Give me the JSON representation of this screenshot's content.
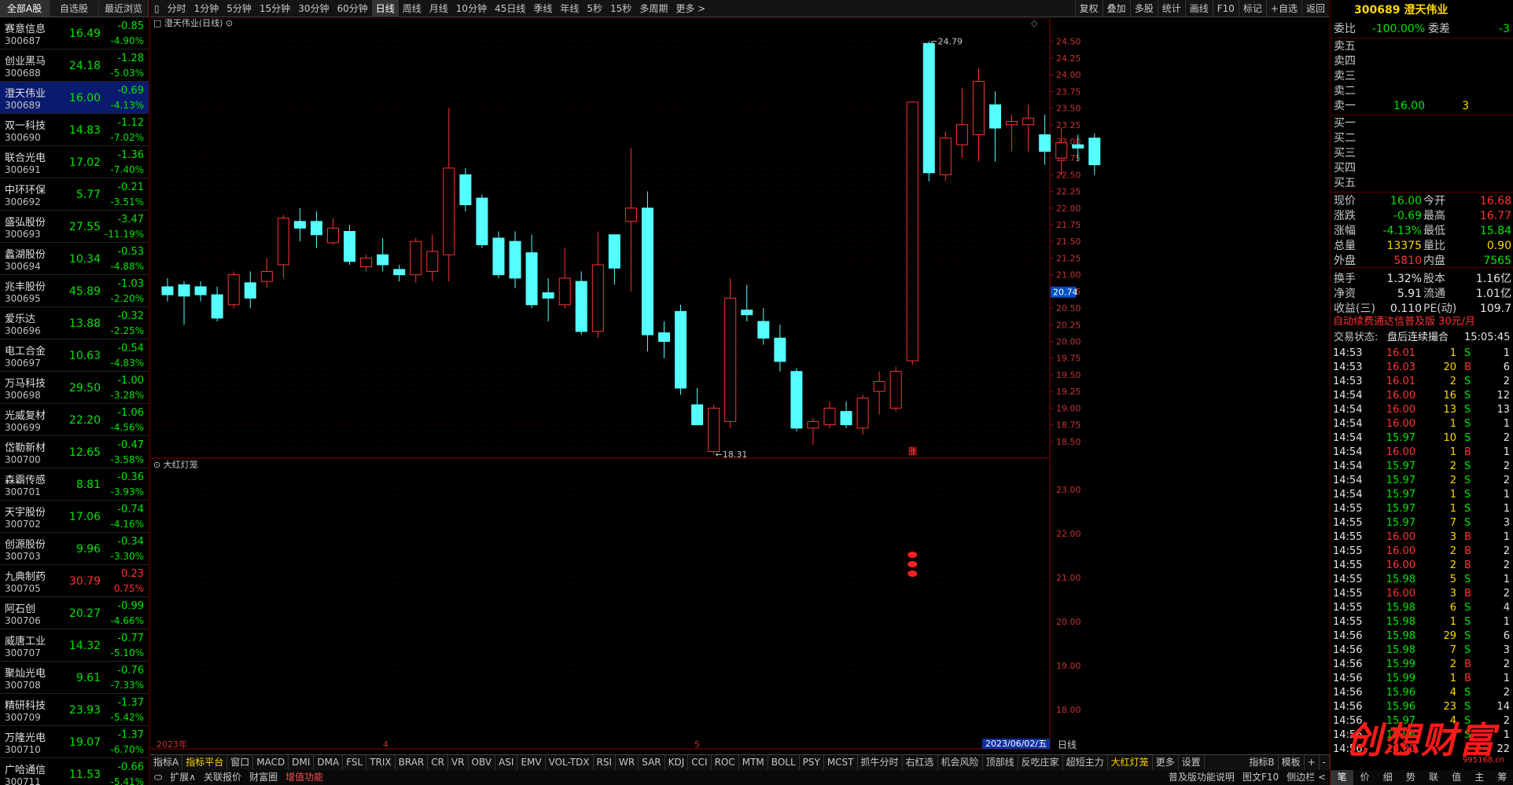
{
  "left_tabs": [
    "全部A股",
    "自选股",
    "最近浏览"
  ],
  "stocks": [
    {
      "name": "赛意信息",
      "code": "300687",
      "price": "16.49",
      "chg": "-0.85",
      "pct": "-4.90%",
      "dir": "dn"
    },
    {
      "name": "创业黑马",
      "code": "300688",
      "price": "24.18",
      "chg": "-1.28",
      "pct": "-5.03%",
      "dir": "dn"
    },
    {
      "name": "澄天伟业",
      "code": "300689",
      "price": "16.00",
      "chg": "-0.69",
      "pct": "-4.13%",
      "dir": "dn",
      "sel": true
    },
    {
      "name": "双一科技",
      "code": "300690",
      "price": "14.83",
      "chg": "-1.12",
      "pct": "-7.02%",
      "dir": "dn"
    },
    {
      "name": "联合光电",
      "code": "300691",
      "price": "17.02",
      "chg": "-1.36",
      "pct": "-7.40%",
      "dir": "dn"
    },
    {
      "name": "中环环保",
      "code": "300692",
      "price": "5.77",
      "chg": "-0.21",
      "pct": "-3.51%",
      "dir": "dn"
    },
    {
      "name": "盛弘股份",
      "code": "300693",
      "price": "27.55",
      "chg": "-3.47",
      "pct": "-11.19%",
      "dir": "dn"
    },
    {
      "name": "蠡湖股份",
      "code": "300694",
      "price": "10.34",
      "chg": "-0.53",
      "pct": "-4.88%",
      "dir": "dn"
    },
    {
      "name": "兆丰股份",
      "code": "300695",
      "price": "45.89",
      "chg": "-1.03",
      "pct": "-2.20%",
      "dir": "dn"
    },
    {
      "name": "爱乐达",
      "code": "300696",
      "price": "13.88",
      "chg": "-0.32",
      "pct": "-2.25%",
      "dir": "dn"
    },
    {
      "name": "电工合金",
      "code": "300697",
      "price": "10.63",
      "chg": "-0.54",
      "pct": "-4.83%",
      "dir": "dn"
    },
    {
      "name": "万马科技",
      "code": "300698",
      "price": "29.50",
      "chg": "-1.00",
      "pct": "-3.28%",
      "dir": "dn"
    },
    {
      "name": "光威复材",
      "code": "300699",
      "price": "22.20",
      "chg": "-1.06",
      "pct": "-4.56%",
      "dir": "dn"
    },
    {
      "name": "岱勒新材",
      "code": "300700",
      "price": "12.65",
      "chg": "-0.47",
      "pct": "-3.58%",
      "dir": "dn"
    },
    {
      "name": "森霸传感",
      "code": "300701",
      "price": "8.81",
      "chg": "-0.36",
      "pct": "-3.93%",
      "dir": "dn"
    },
    {
      "name": "天宇股份",
      "code": "300702",
      "price": "17.06",
      "chg": "-0.74",
      "pct": "-4.16%",
      "dir": "dn"
    },
    {
      "name": "创源股份",
      "code": "300703",
      "price": "9.96",
      "chg": "-0.34",
      "pct": "-3.30%",
      "dir": "dn"
    },
    {
      "name": "九典制药",
      "code": "300705",
      "price": "30.79",
      "chg": "0.23",
      "pct": "0.75%",
      "dir": "up"
    },
    {
      "name": "阿石创",
      "code": "300706",
      "price": "20.27",
      "chg": "-0.99",
      "pct": "-4.66%",
      "dir": "dn"
    },
    {
      "name": "威唐工业",
      "code": "300707",
      "price": "14.32",
      "chg": "-0.77",
      "pct": "-5.10%",
      "dir": "dn"
    },
    {
      "name": "聚灿光电",
      "code": "300708",
      "price": "9.61",
      "chg": "-0.76",
      "pct": "-7.33%",
      "dir": "dn"
    },
    {
      "name": "精研科技",
      "code": "300709",
      "price": "23.93",
      "chg": "-1.37",
      "pct": "-5.42%",
      "dir": "dn"
    },
    {
      "name": "万隆光电",
      "code": "300710",
      "price": "19.07",
      "chg": "-1.37",
      "pct": "-6.70%",
      "dir": "dn"
    },
    {
      "name": "广哈通信",
      "code": "300711",
      "price": "11.53",
      "chg": "-0.66",
      "pct": "-5.41%",
      "dir": "dn"
    }
  ],
  "top_tabs": [
    "分时",
    "1分钟",
    "5分钟",
    "15分钟",
    "30分钟",
    "60分钟",
    "日线",
    "周线",
    "月线",
    "10分钟",
    "45日线",
    "季线",
    "年线",
    "5秒",
    "15秒",
    "多周期",
    "更多 >"
  ],
  "top_active": "日线",
  "top_right": [
    "复权",
    "叠加",
    "多股",
    "统计",
    "画线",
    "F10",
    "标记",
    "+自选",
    "返回"
  ],
  "chart_title": "澄天伟业(日线)",
  "ind_title": "大红灯笼",
  "chart_data": {
    "type": "candlestick",
    "ylim": [
      18.25,
      24.85
    ],
    "yticks": [
      "24.50",
      "24.25",
      "24.00",
      "23.75",
      "23.50",
      "23.25",
      "23.00",
      "22.75",
      "22.50",
      "22.25",
      "22.00",
      "21.75",
      "21.50",
      "21.25",
      "21.00",
      "20.75",
      "20.50",
      "20.25",
      "20.00",
      "19.75",
      "19.50",
      "19.25",
      "19.00",
      "18.75",
      "18.50"
    ],
    "price_label": "20.74",
    "high_label": "24.79",
    "low_label": "18.31",
    "x_labels": [
      "2023年",
      "4",
      "5"
    ],
    "date_label": "2023/06/02/五",
    "ind_yticks": [
      "23.00",
      "22.00",
      "21.00",
      "20.00",
      "19.00",
      "18.00"
    ],
    "candles": [
      [
        20.82,
        20.7,
        20.95,
        20.6
      ],
      [
        20.85,
        20.68,
        20.9,
        20.25
      ],
      [
        20.82,
        20.7,
        20.9,
        20.6
      ],
      [
        20.7,
        20.35,
        20.82,
        20.3
      ],
      [
        20.55,
        21.0,
        21.05,
        20.5
      ],
      [
        20.88,
        20.65,
        21.05,
        20.5
      ],
      [
        20.9,
        21.05,
        21.25,
        20.8
      ],
      [
        21.15,
        21.85,
        21.9,
        20.95
      ],
      [
        21.8,
        21.7,
        22.0,
        21.5
      ],
      [
        21.8,
        21.6,
        21.95,
        21.4
      ],
      [
        21.48,
        21.7,
        21.85,
        21.45
      ],
      [
        21.65,
        21.2,
        21.75,
        21.15
      ],
      [
        21.12,
        21.25,
        21.3,
        21.05
      ],
      [
        21.3,
        21.15,
        21.55,
        21.05
      ],
      [
        21.08,
        21.0,
        21.15,
        20.9
      ],
      [
        21.0,
        21.5,
        21.55,
        20.88
      ],
      [
        21.05,
        21.35,
        21.6,
        20.9
      ],
      [
        21.3,
        22.6,
        23.5,
        20.9
      ],
      [
        22.5,
        22.05,
        22.6,
        21.95
      ],
      [
        22.15,
        21.45,
        22.2,
        21.4
      ],
      [
        21.55,
        21.0,
        21.65,
        20.95
      ],
      [
        21.5,
        20.95,
        21.65,
        20.8
      ],
      [
        21.33,
        20.55,
        21.6,
        20.5
      ],
      [
        20.73,
        20.65,
        20.95,
        20.3
      ],
      [
        20.55,
        20.95,
        21.4,
        20.5
      ],
      [
        20.9,
        20.15,
        21.05,
        20.1
      ],
      [
        20.15,
        21.15,
        21.65,
        20.05
      ],
      [
        21.6,
        21.1,
        21.55,
        20.85
      ],
      [
        21.8,
        22.0,
        22.9,
        20.75
      ],
      [
        22.0,
        20.1,
        22.25,
        19.85
      ],
      [
        20.13,
        20.0,
        20.3,
        19.75
      ],
      [
        20.45,
        19.3,
        20.55,
        19.2
      ],
      [
        19.05,
        18.75,
        19.3,
        18.75
      ],
      [
        18.35,
        19.0,
        19.05,
        18.31
      ],
      [
        18.8,
        20.65,
        20.95,
        18.7
      ],
      [
        20.47,
        20.4,
        20.85,
        20.3
      ],
      [
        20.3,
        20.05,
        20.5,
        19.95
      ],
      [
        20.05,
        19.7,
        20.25,
        19.55
      ],
      [
        19.55,
        18.7,
        19.6,
        18.65
      ],
      [
        18.7,
        18.8,
        18.85,
        18.45
      ],
      [
        18.75,
        19.0,
        19.1,
        18.7
      ],
      [
        18.95,
        18.75,
        19.1,
        18.7
      ],
      [
        18.7,
        19.15,
        19.2,
        18.6
      ],
      [
        19.25,
        19.4,
        19.55,
        18.9
      ],
      [
        19.0,
        19.55,
        19.62,
        18.95
      ],
      [
        19.71,
        23.59,
        23.6,
        19.65
      ],
      [
        24.47,
        22.53,
        24.5,
        22.4
      ],
      [
        22.5,
        23.05,
        23.15,
        22.4
      ],
      [
        22.95,
        23.25,
        23.8,
        22.75
      ],
      [
        23.1,
        23.9,
        24.1,
        22.7
      ],
      [
        23.55,
        23.2,
        23.75,
        22.7
      ],
      [
        23.25,
        23.3,
        23.4,
        22.85
      ],
      [
        23.25,
        23.35,
        23.55,
        22.85
      ],
      [
        23.1,
        22.85,
        23.4,
        22.65
      ],
      [
        22.75,
        22.98,
        23.2,
        22.5
      ],
      [
        22.95,
        22.9,
        23.1,
        22.7
      ],
      [
        23.05,
        22.65,
        23.12,
        22.5
      ]
    ],
    "up_candle_label": "涨"
  },
  "quote": {
    "code": "300689",
    "name": "澄天伟业",
    "weibi_label": "委比",
    "weibi": "-100.00%",
    "weicha_label": "委差",
    "weicha": "-3",
    "sell": [
      [
        "卖五",
        "",
        ""
      ],
      [
        "卖四",
        "",
        ""
      ],
      [
        "卖三",
        "",
        ""
      ],
      [
        "卖二",
        "",
        ""
      ],
      [
        "卖一",
        "16.00",
        "3"
      ]
    ],
    "buy": [
      [
        "买一",
        "",
        ""
      ],
      [
        "买二",
        "",
        ""
      ],
      [
        "买三",
        "",
        ""
      ],
      [
        "买四",
        "",
        ""
      ],
      [
        "买五",
        "",
        ""
      ]
    ],
    "stats": [
      [
        "现价",
        "16.00",
        "dn",
        "今开",
        "16.68",
        "up"
      ],
      [
        "涨跌",
        "-0.69",
        "dn",
        "最高",
        "16.77",
        "up"
      ],
      [
        "涨幅",
        "-4.13%",
        "dn",
        "最低",
        "15.84",
        "dn"
      ],
      [
        "总量",
        "13375",
        "yl",
        "量比",
        "0.90",
        "yl"
      ],
      [
        "外盘",
        "5810",
        "up",
        "内盘",
        "7565",
        "dn"
      ],
      [
        "换手",
        "1.32%",
        "wh",
        "股本",
        "1.16亿",
        "wh"
      ],
      [
        "净资",
        "5.91",
        "wh",
        "流通",
        "1.01亿",
        "wh"
      ],
      [
        "收益(三)",
        "0.110",
        "wh",
        "PE(动)",
        "109.7",
        "wh"
      ]
    ],
    "ad": "自动续费通达信普及版 30元/月",
    "status_label": "交易状态:",
    "status": "盘后连续撮合",
    "status_time": "15:05:45",
    "ticks": [
      [
        "14:53",
        "16.01",
        "1",
        "S",
        "1"
      ],
      [
        "14:53",
        "16.03",
        "20",
        "B",
        "6"
      ],
      [
        "14:53",
        "16.01",
        "2",
        "S",
        "2"
      ],
      [
        "14:54",
        "16.00",
        "16",
        "S",
        "12"
      ],
      [
        "14:54",
        "16.00",
        "13",
        "S",
        "13"
      ],
      [
        "14:54",
        "16.00",
        "1",
        "S",
        "1"
      ],
      [
        "14:54",
        "15.97",
        "10",
        "S",
        "2"
      ],
      [
        "14:54",
        "16.00",
        "1",
        "B",
        "1"
      ],
      [
        "14:54",
        "15.97",
        "2",
        "S",
        "2"
      ],
      [
        "14:54",
        "15.97",
        "2",
        "S",
        "2"
      ],
      [
        "14:54",
        "15.97",
        "1",
        "S",
        "1"
      ],
      [
        "14:55",
        "15.97",
        "1",
        "S",
        "1"
      ],
      [
        "14:55",
        "15.97",
        "7",
        "S",
        "3"
      ],
      [
        "14:55",
        "16.00",
        "3",
        "B",
        "1"
      ],
      [
        "14:55",
        "16.00",
        "2",
        "B",
        "2"
      ],
      [
        "14:55",
        "16.00",
        "2",
        "B",
        "2"
      ],
      [
        "14:55",
        "15.98",
        "5",
        "S",
        "1"
      ],
      [
        "14:55",
        "16.00",
        "3",
        "B",
        "2"
      ],
      [
        "14:55",
        "15.98",
        "6",
        "S",
        "4"
      ],
      [
        "14:55",
        "15.98",
        "1",
        "S",
        "1"
      ],
      [
        "14:56",
        "15.98",
        "29",
        "S",
        "6"
      ],
      [
        "14:56",
        "15.98",
        "7",
        "S",
        "3"
      ],
      [
        "14:56",
        "15.99",
        "2",
        "B",
        "2"
      ],
      [
        "14:56",
        "15.99",
        "1",
        "B",
        "1"
      ],
      [
        "14:56",
        "15.96",
        "4",
        "S",
        "2"
      ],
      [
        "14:56",
        "15.96",
        "23",
        "S",
        "14"
      ],
      [
        "14:56",
        "15.97",
        "4",
        "S",
        "2"
      ],
      [
        "14:56",
        "15.96",
        "3",
        "S",
        "1"
      ],
      [
        "14:56",
        "16.00",
        "",
        "",
        "22"
      ]
    ],
    "bottom_tabs": [
      "笔",
      "价",
      "细",
      "势",
      "联",
      "值",
      "主",
      "筹"
    ]
  },
  "bottom_tabs": [
    "指标A",
    "指标平台",
    "窗口",
    "MACD",
    "DMI",
    "DMA",
    "FSL",
    "TRIX",
    "BRAR",
    "CR",
    "VR",
    "OBV",
    "ASI",
    "EMV",
    "VOL-TDX",
    "RSI",
    "WR",
    "SAR",
    "KDJ",
    "CCI",
    "ROC",
    "MTM",
    "BOLL",
    "PSY",
    "MCST",
    "抓牛分时",
    "右红选",
    "机会风险",
    "顶部线",
    "反吃庄家",
    "超短主力",
    "大红灯笼",
    "更多",
    "设置"
  ],
  "bottom_active": [
    "指标平台",
    "大红灯笼"
  ],
  "bottom_right": [
    "指标B",
    "模板",
    "+",
    "-"
  ],
  "bottom2": [
    "扩展∧",
    "关联报价",
    "财富圈",
    "增值功能"
  ],
  "bottom2_right": [
    "普及版功能说明",
    "图文F10",
    "侧边栏 <"
  ],
  "period_label": "日线",
  "watermark": "创想财富",
  "watermark_sub": "995168.cn"
}
